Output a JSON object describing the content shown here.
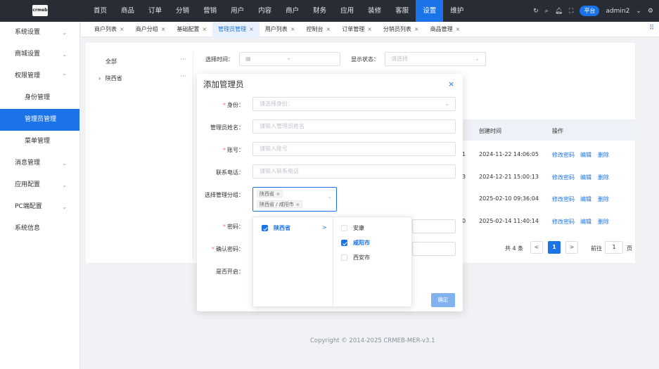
{
  "header": {
    "logo_text": "crmeb",
    "menu": [
      "首页",
      "商品",
      "订单",
      "分销",
      "营销",
      "用户",
      "内容",
      "商户",
      "财务",
      "应用",
      "装修",
      "客服",
      "设置",
      "维护"
    ],
    "active_menu_index": 12,
    "platform_badge": "平台",
    "username": "admin2",
    "icons": [
      "refresh-icon",
      "search-icon",
      "bell-icon",
      "fullscreen-icon",
      "chevron-down-icon",
      "gear-icon"
    ]
  },
  "sidebar": {
    "items": [
      {
        "label": "系统设置",
        "arrow": "⌄"
      },
      {
        "label": "商城设置",
        "arrow": "⌄"
      },
      {
        "label": "权限管理",
        "arrow": "⌃"
      },
      {
        "label": "身份管理",
        "sub": true
      },
      {
        "label": "管理员管理",
        "sub": true,
        "active": true
      },
      {
        "label": "菜单管理",
        "sub": true
      },
      {
        "label": "消息管理",
        "arrow": "⌄"
      },
      {
        "label": "应用配置",
        "arrow": "⌄"
      },
      {
        "label": "PC端配置",
        "arrow": "⌄"
      },
      {
        "label": "系统信息"
      }
    ]
  },
  "tabs": {
    "items": [
      "商户列表",
      "商户分组",
      "基础配置",
      "管理员管理",
      "用户列表",
      "控制台",
      "订单管理",
      "分销员列表",
      "商品管理"
    ],
    "active_index": 3,
    "close_glyph": "×"
  },
  "tree": {
    "all": "全部",
    "province": "陕西省",
    "more": "···"
  },
  "filters": {
    "time_label": "选择时间：",
    "time_sep": "-",
    "status_label": "显示状态：",
    "status_placeholder": "请选择"
  },
  "table": {
    "headers": [
      "创建时间",
      "操作"
    ],
    "rows": [
      {
        "suffix": "1",
        "created": "2024-11-22 14:06:05"
      },
      {
        "suffix": "3",
        "created": "2024-12-21 15:00:13"
      },
      {
        "suffix": "",
        "created": "2025-02-10 09:36:04"
      },
      {
        "suffix": "0",
        "created": "2025-02-14 11:40:14"
      }
    ],
    "actions": [
      "修改密码",
      "编辑",
      "删除"
    ]
  },
  "pagination": {
    "total": "共 4 条",
    "prev": "<",
    "current": "1",
    "next": ">",
    "goto_label": "前往",
    "goto_value": "1",
    "page_unit": "页"
  },
  "footer": {
    "copyright": "Copyright © 2014-2025 CRMEB-MER-v3.1"
  },
  "dialog": {
    "title": "添加管理员",
    "close": "×",
    "fields": {
      "identity_label": "身份：",
      "identity_placeholder": "请选择身份：",
      "name_label": "管理员姓名：",
      "name_placeholder": "请输入管理员姓名",
      "account_label": "账号：",
      "account_placeholder": "请输入账号",
      "phone_label": "联系电话：",
      "phone_placeholder": "请输入联系电话",
      "group_label": "选择管理分组：",
      "group_tags": [
        "陕西省",
        "陕西省 / 咸阳市"
      ],
      "password_label": "密码：",
      "confirm_label": "确认密码：",
      "enable_label": "是否开启："
    },
    "cascader": {
      "level1": [
        {
          "label": "陕西省",
          "checked": true,
          "arrow": ">"
        }
      ],
      "level2": [
        {
          "label": "安康",
          "checked": false
        },
        {
          "label": "咸阳市",
          "checked": true
        },
        {
          "label": "西安市",
          "checked": false
        }
      ]
    },
    "confirm_button": "确定"
  },
  "colors": {
    "primary": "#1a73e8",
    "topbar": "#282c34",
    "danger": "#f56c6c"
  }
}
